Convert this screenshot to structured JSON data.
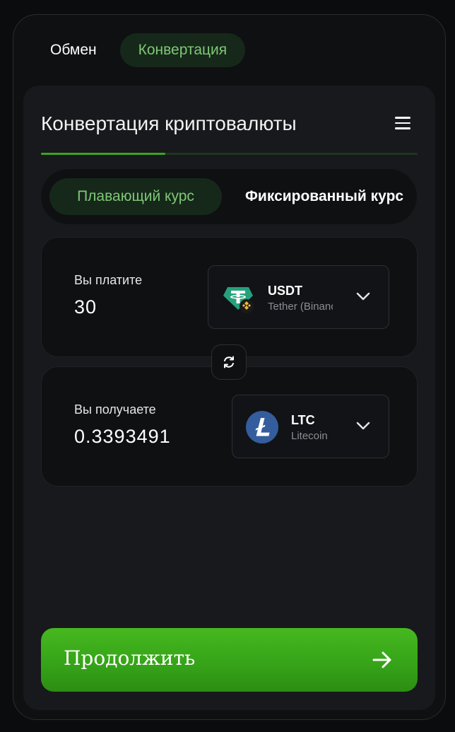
{
  "top_tabs": [
    {
      "label": "Обмен",
      "active": false
    },
    {
      "label": "Конвертация",
      "active": true
    }
  ],
  "card": {
    "title": "Конвертация криптовалюты",
    "progress": 0.33
  },
  "rate_toggle": {
    "floating_label": "Плавающий курс",
    "fixed_label": "Фиксированный курс",
    "selected": "floating"
  },
  "pay": {
    "label": "Вы платите",
    "amount": "30",
    "coin": {
      "ticker": "USDT",
      "name": "Tether (Binance)",
      "icon": "usdt-bep20-icon"
    }
  },
  "receive": {
    "label": "Вы получаете",
    "amount": "0.3393491",
    "coin": {
      "ticker": "LTC",
      "name": "Litecoin",
      "icon": "litecoin-icon"
    }
  },
  "continue_button": {
    "label": "Продолжить"
  },
  "colors": {
    "accent": "#3ea31f",
    "accent_text": "#7fc776",
    "tether": "#26a17b",
    "binance": "#f3ba2f",
    "litecoin": "#345d9d"
  }
}
